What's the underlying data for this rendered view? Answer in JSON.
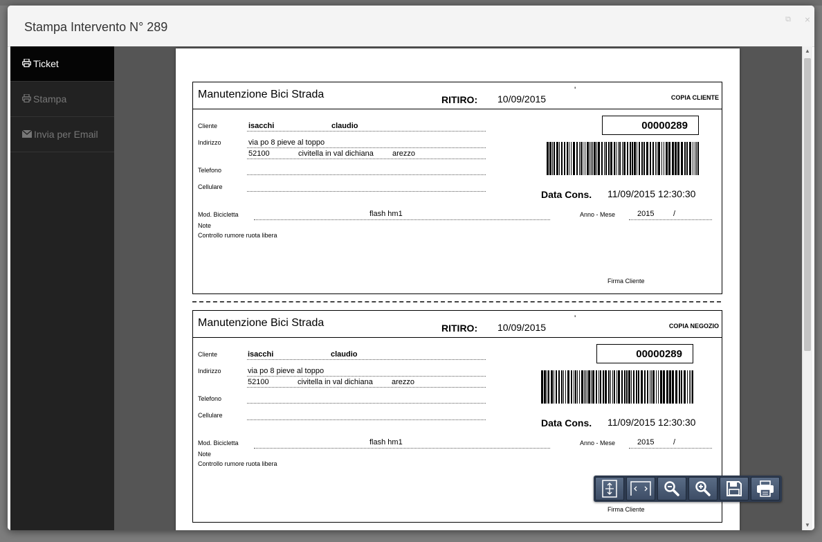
{
  "modal": {
    "title": "Stampa Intervento N° 289",
    "restore_icon": "restore-icon",
    "close_icon": "close-icon",
    "close_glyph": "×",
    "restore_glyph": "⧉"
  },
  "sidebar": {
    "items": [
      {
        "label": "Ticket",
        "icon": "print-icon",
        "glyph": "🖶"
      },
      {
        "label": "Stampa",
        "icon": "print-icon",
        "glyph": "🖶"
      },
      {
        "label": "Invia per Email",
        "icon": "envelope-icon",
        "glyph": "✉"
      }
    ]
  },
  "tickets": [
    {
      "shop": "Manutenzione Bici Strada",
      "ritiro_label": "RITIRO:",
      "ritiro_date": "10/09/2015",
      "mark": "'",
      "copia": "COPIA CLIENTE",
      "cliente_label": "Cliente",
      "cliente_cognome": "isacchi",
      "cliente_nome": "claudio",
      "indirizzo_label": "Indirizzo",
      "indirizzo": "via po 8 pieve al toppo",
      "cap": "52100",
      "citta": "civitella in val dichiana",
      "provincia": "arezzo",
      "telefono_label": "Telefono",
      "cellulare_label": "Cellulare",
      "ticket_no": "00000289",
      "data_cons_label": "Data Cons.",
      "data_cons": "11/09/2015  12:30:30",
      "mod_label": "Mod. Bicicletta",
      "mod": "flash hm1",
      "anno_label": "Anno - Mese",
      "anno": "2015",
      "slash": "/",
      "note_label": "Note",
      "note": "Controllo rumore ruota libera",
      "firma": "Firma Cliente"
    },
    {
      "shop": "Manutenzione Bici Strada",
      "ritiro_label": "RITIRO:",
      "ritiro_date": "10/09/2015",
      "mark": "'",
      "copia": "COPIA  NEGOZIO",
      "cliente_label": "Cliente",
      "cliente_cognome": "isacchi",
      "cliente_nome": "claudio",
      "indirizzo_label": "Indirizzo",
      "indirizzo": "via po 8 pieve al toppo",
      "cap": "52100",
      "citta": "civitella in val dichiana",
      "provincia": "arezzo",
      "telefono_label": "Telefono",
      "cellulare_label": "Cellulare",
      "ticket_no": "00000289",
      "data_cons_label": "Data Cons.",
      "data_cons": "11/09/2015  12:30:30",
      "mod_label": "Mod. Bicicletta",
      "mod": "flash hm1",
      "anno_label": "Anno - Mese",
      "anno": "2015",
      "slash": "/",
      "note_label": "Note",
      "note": "Controllo rumore ruota libera",
      "firma": "Firma Cliente"
    }
  ],
  "toolbar": {
    "buttons": [
      {
        "icon": "fit-page-icon"
      },
      {
        "icon": "fit-width-icon"
      },
      {
        "icon": "zoom-out-icon"
      },
      {
        "icon": "zoom-in-icon"
      },
      {
        "icon": "save-icon"
      },
      {
        "icon": "printer-icon"
      }
    ]
  },
  "colors": {
    "sidebar_bg": "#222222",
    "sidebar_active": "#050505",
    "toolbar_bg": "#2d3a4f",
    "viewer_bg": "#555555"
  }
}
